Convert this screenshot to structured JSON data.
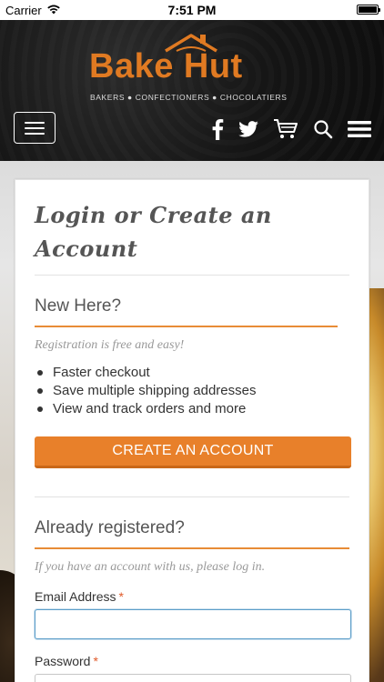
{
  "status_bar": {
    "carrier": "Carrier",
    "time": "7:51 PM"
  },
  "header": {
    "brand": "Bake Hut",
    "tagline": "BAKERS ● CONFECTIONERS ● CHOCOLATIERS",
    "icons": [
      "facebook-icon",
      "twitter-icon",
      "cart-icon",
      "search-icon",
      "menu-icon"
    ],
    "accent_color": "#e07a22"
  },
  "page": {
    "title_line1": "Login or Create an",
    "title_line2": "Account"
  },
  "new_here": {
    "heading": "New Here?",
    "subtext": "Registration is free and easy!",
    "bullets": [
      "Faster checkout",
      "Save multiple shipping addresses",
      "View and track orders and more"
    ],
    "button_label": "CREATE AN ACCOUNT"
  },
  "login": {
    "heading": "Already registered?",
    "subtext": "If you have an account with us, please log in.",
    "email_label": "Email Address",
    "password_label": "Password",
    "required_mark": "*",
    "email_value": "",
    "password_value": ""
  }
}
